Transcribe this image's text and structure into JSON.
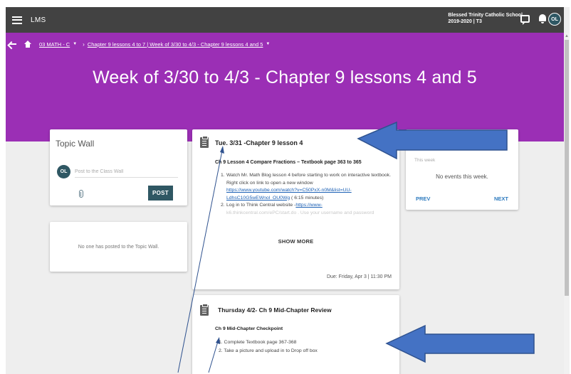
{
  "app": {
    "title": "LMS"
  },
  "school": {
    "name": "Blessed Trinity Catholic School",
    "term": "2019-2020 | T3"
  },
  "user": {
    "initials": "OL"
  },
  "breadcrumb": {
    "course": "03 MATH - C",
    "folder": "Chapter 9 lessons 4 to 7",
    "separator": "|",
    "current": "Week of 3/30 to 4/3 - Chapter 9 lessons 4 and 5"
  },
  "page": {
    "title": "Week of 3/30 to 4/3 - Chapter 9 lessons 4 and 5"
  },
  "topic_wall": {
    "title": "Topic Wall",
    "placeholder": "Post to the Class Wall",
    "post_label": "POST",
    "empty_text": "No one has posted to the Topic Wall."
  },
  "assignments": [
    {
      "title": "Tue. 3/31 -Chapter 9 lesson 4",
      "subtitle": "Ch 9 Lesson 4 Compare Fractions – Textbook page 363 to 365",
      "step1_num": "1.",
      "step1_text": "Watch Mr. Math Blog lesson 4 before starting to work on interactive textbook. Right click on link to open a new window",
      "step1_link_a": "https://www.youtube.com/watch?v=C50PxX-n0M&list=UU-",
      "step1_link_b": "LdhsC10G5wEWnol_OU0Wg",
      "step1_duration": "( 6:15 minutes)",
      "step2_num": "2.",
      "step2_text": "Log in to Think Central website -",
      "step2_link": "https://www-",
      "step2_faded": "k6.thinkcentral.com/ePC/start.do . Use your username and password",
      "show_more": "SHOW MORE",
      "due": "Due: Friday, Apr 3 | 11:30 PM"
    },
    {
      "title": "Thursday 4/2- Ch 9 Mid-Chapter Review",
      "subtitle": "Ch 9 Mid-Chapter Checkpoint",
      "items": [
        "1. Complete Textbook page 367-368",
        "2. Take a picture and upload  in to Drop off box"
      ]
    }
  ],
  "events": {
    "label": "This week",
    "empty_text": "No events this week.",
    "prev_label": "PREV",
    "next_label": "NEXT"
  },
  "colors": {
    "header_purple": "#9b2fb5",
    "topbar": "#424242",
    "accent_teal": "#2f5763",
    "link_blue": "#2e7bbf",
    "annotation_arrow": "#4472c4"
  },
  "icons": [
    "hamburger-icon",
    "back-arrow-icon",
    "home-icon",
    "chat-icon",
    "bell-icon",
    "assignment-icon",
    "attachment-icon"
  ]
}
